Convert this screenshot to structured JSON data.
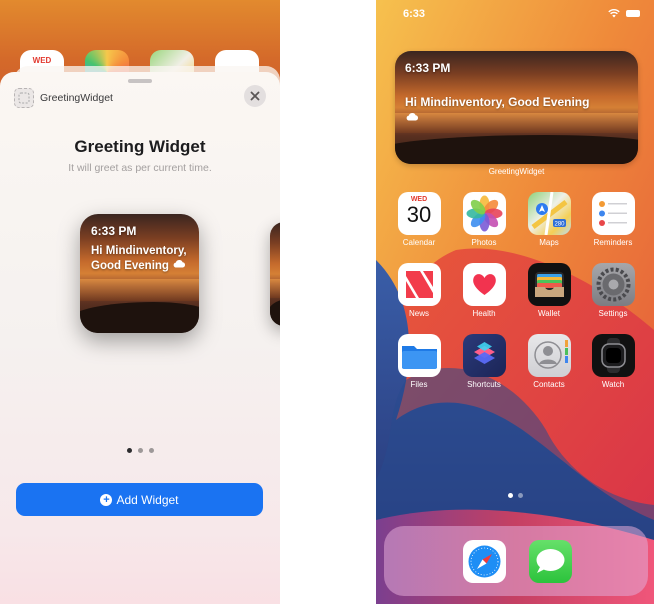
{
  "gallery": {
    "app_name": "GreetingWidget",
    "title": "Greeting Widget",
    "subtitle": "It will greet as per current time.",
    "widget": {
      "time": "6:33 PM",
      "greeting": "Hi Mindinventory, Good Evening"
    },
    "add_button_label": "Add Widget",
    "page_count": 3,
    "current_page": 1,
    "background_calendar_day": "WED"
  },
  "home": {
    "status_time": "6:33",
    "widget": {
      "time": "6:33 PM",
      "greeting": "Hi Mindinventory, Good Evening",
      "caption": "GreetingWidget"
    },
    "apps": [
      {
        "label": "Calendar",
        "icon": "calendar-icon",
        "day": "WED",
        "date": "30"
      },
      {
        "label": "Photos",
        "icon": "photos-icon"
      },
      {
        "label": "Maps",
        "icon": "maps-icon",
        "badge": "280"
      },
      {
        "label": "Reminders",
        "icon": "reminders-icon"
      },
      {
        "label": "News",
        "icon": "news-icon"
      },
      {
        "label": "Health",
        "icon": "health-icon"
      },
      {
        "label": "Wallet",
        "icon": "wallet-icon"
      },
      {
        "label": "Settings",
        "icon": "settings-icon"
      },
      {
        "label": "Files",
        "icon": "files-icon"
      },
      {
        "label": "Shortcuts",
        "icon": "shortcuts-icon"
      },
      {
        "label": "Contacts",
        "icon": "contacts-icon"
      },
      {
        "label": "Watch",
        "icon": "watch-icon"
      }
    ],
    "dock": [
      {
        "icon": "safari-icon"
      },
      {
        "icon": "messages-icon"
      }
    ],
    "page_count": 2,
    "current_page": 1
  },
  "colors": {
    "accent": "#1a73f2",
    "sunset": "#c56a2c"
  }
}
